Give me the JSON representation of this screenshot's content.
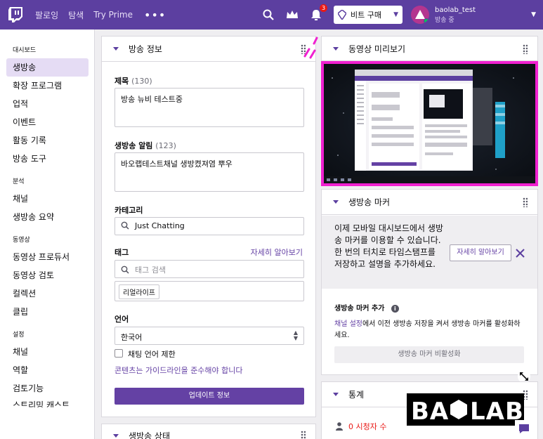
{
  "nav": {
    "links": [
      "팔로잉",
      "탐색",
      "Try Prime"
    ],
    "more": "•••",
    "notif_count": "3",
    "bits_label": "비트 구매",
    "username": "baolab_test",
    "status": "방송 중"
  },
  "sidebar": {
    "sections": [
      {
        "title": "대시보드",
        "items": [
          "생방송",
          "확장 프로그램",
          "업적",
          "이벤트",
          "활동 기록",
          "방송 도구"
        ]
      },
      {
        "title": "분석",
        "items": [
          "채널",
          "생방송 요약"
        ]
      },
      {
        "title": "동영상",
        "items": [
          "동영상 프로듀서",
          "동영상 검토",
          "컬렉션",
          "클립"
        ]
      },
      {
        "title": "설정",
        "items": [
          "채널",
          "역할",
          "검토기능"
        ]
      }
    ],
    "partial_item": "스트리밍 캐스트"
  },
  "stream_info": {
    "header": "방송 정보",
    "title_label": "제목",
    "title_count": "(130)",
    "title_value": "방송 뉴비 테스트중",
    "notif_label": "생방송 알림",
    "notif_count": "(123)",
    "notif_value": "바오랩테스트채널 생방켰져염 뿌우",
    "category_label": "카테고리",
    "category_value": "Just Chatting",
    "tags_label": "태그",
    "tags_learn_more": "자세히 알아보기",
    "tags_placeholder": "태그 검색",
    "tag_chip": "리얼라이프",
    "language_label": "언어",
    "language_value": "한국어",
    "chat_lang_restrict": "채팅 언어 제한",
    "guideline_link": "콘텐츠는 가이드라인을 준수해야 합니다",
    "update_button": "업데이트 정보"
  },
  "stream_status": {
    "header": "생방송 상태"
  },
  "preview": {
    "header": "동영상 미리보기"
  },
  "markers": {
    "header": "생방송 마커",
    "promo_text": "이제 모바일 대시보드에서 생방송 마커를 이용할 수 있습니다. 한 번의 터치로 타임스탬프를 저장하고 설명을 추가하세요.",
    "learn_more": "자세히 알아보기",
    "add_label": "생방송 마커 추가",
    "channel_settings_link": "채널 설정",
    "desc_rest": "에서 이전 생방송 저장을 켜서 생방송 마커를 활성화하세요.",
    "disabled_button": "생방송 마커 비활성화"
  },
  "stats": {
    "header": "통계",
    "viewers": "0 시청자 수"
  },
  "watermark": {
    "text": "BA LAB"
  },
  "colors": {
    "nav": "#5c3fa0",
    "accent": "#6441a4",
    "highlight": "#f020d0"
  }
}
